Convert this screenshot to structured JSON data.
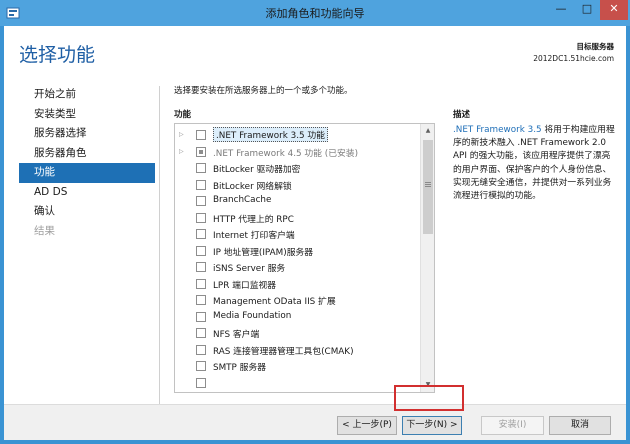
{
  "window": {
    "title": "添加角色和功能向导",
    "min_glyph": "—",
    "max_glyph": "□",
    "close_glyph": "✕"
  },
  "header": {
    "page_title": "选择功能",
    "server_label_title": "目标服务器",
    "server_name": "2012DC1.51hcie.com"
  },
  "nav": {
    "items": [
      {
        "label": "开始之前",
        "state": "normal"
      },
      {
        "label": "安装类型",
        "state": "normal"
      },
      {
        "label": "服务器选择",
        "state": "normal"
      },
      {
        "label": "服务器角色",
        "state": "normal"
      },
      {
        "label": "功能",
        "state": "active"
      },
      {
        "label": "AD DS",
        "state": "normal"
      },
      {
        "label": "确认",
        "state": "normal"
      },
      {
        "label": "结果",
        "state": "disabled"
      }
    ]
  },
  "main": {
    "instruction": "选择要安装在所选服务器上的一个或多个功能。",
    "features_label": "功能",
    "description_label": "描述",
    "features": [
      {
        "label": ".NET Framework 3.5 功能",
        "expander": true,
        "checkbox": "unchecked",
        "selected": true
      },
      {
        "label": ".NET Framework 4.5 功能 (已安装)",
        "expander": true,
        "checkbox": "partial",
        "installed": true
      },
      {
        "label": "BitLocker 驱动器加密",
        "checkbox": "unchecked"
      },
      {
        "label": "BitLocker 网络解锁",
        "checkbox": "unchecked"
      },
      {
        "label": "BranchCache",
        "checkbox": "unchecked"
      },
      {
        "label": "HTTP 代理上的 RPC",
        "checkbox": "unchecked"
      },
      {
        "label": "Internet 打印客户端",
        "checkbox": "unchecked"
      },
      {
        "label": "IP 地址管理(IPAM)服务器",
        "checkbox": "unchecked"
      },
      {
        "label": "iSNS Server 服务",
        "checkbox": "unchecked"
      },
      {
        "label": "LPR 端口监视器",
        "checkbox": "unchecked"
      },
      {
        "label": "Management OData IIS 扩展",
        "checkbox": "unchecked"
      },
      {
        "label": "Media Foundation",
        "checkbox": "unchecked"
      },
      {
        "label": "NFS 客户端",
        "checkbox": "unchecked"
      },
      {
        "label": "RAS 连接管理器管理工具包(CMAK)",
        "checkbox": "unchecked"
      },
      {
        "label": "SMTP 服务器",
        "checkbox": "unchecked"
      },
      {
        "label": "",
        "checkbox": "unchecked"
      }
    ],
    "description_highlight": ".NET Framework 3.5",
    "description_rest": " 将用于构建应用程序的新技术融入 .NET Framework 2.0 API 的强大功能，该应用程序提供了漂亮的用户界面、保护客户的个人身份信息、实现无缝安全通信，并提供对一系列业务流程进行模拟的功能。"
  },
  "footer": {
    "prev_label": "< 上一步(P)",
    "next_label": "下一步(N) >",
    "install_label": "安装(I)",
    "cancel_label": "取消"
  },
  "icons": {
    "expander": "▷",
    "scroll_up": "▲",
    "scroll_down": "▼"
  },
  "colors": {
    "accent": "#1e70b5",
    "title_blue": "#1f5fa5",
    "highlight_red": "#d22f2f"
  }
}
